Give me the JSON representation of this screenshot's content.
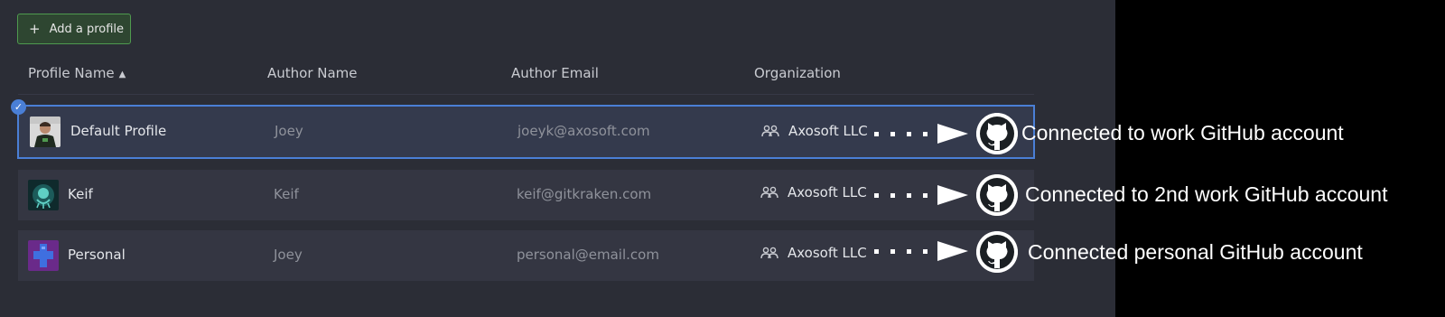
{
  "toolbar": {
    "add_profile_label": "Add a profile"
  },
  "columns": {
    "profile_name": "Profile Name",
    "author_name": "Author Name",
    "author_email": "Author Email",
    "organization": "Organization"
  },
  "rows": [
    {
      "profile_name": "Default Profile",
      "author_name": "Joey",
      "author_email": "joeyk@axosoft.com",
      "organization": "Axosoft LLC",
      "selected": true
    },
    {
      "profile_name": "Keif",
      "author_name": "Keif",
      "author_email": "keif@gitkraken.com",
      "organization": "Axosoft LLC",
      "selected": false
    },
    {
      "profile_name": "Personal",
      "author_name": "Joey",
      "author_email": "personal@email.com",
      "organization": "Axosoft LLC",
      "selected": false
    }
  ],
  "annotations": [
    {
      "text": "Connected to work GitHub account"
    },
    {
      "text": "Connected to 2nd work GitHub account"
    },
    {
      "text": "Connected personal GitHub account"
    }
  ],
  "colors": {
    "panel_bg": "#2b2d36",
    "row_bg": "#343642",
    "selected_border": "#4a7fd6",
    "add_button_border": "#4f9a4f",
    "muted_text": "#8f929b"
  },
  "icons": {
    "add": "plus-icon",
    "sort": "sort-ascending-icon",
    "selected": "check-badge-icon",
    "organization": "users-group-icon",
    "github": "github-octocat-icon"
  }
}
